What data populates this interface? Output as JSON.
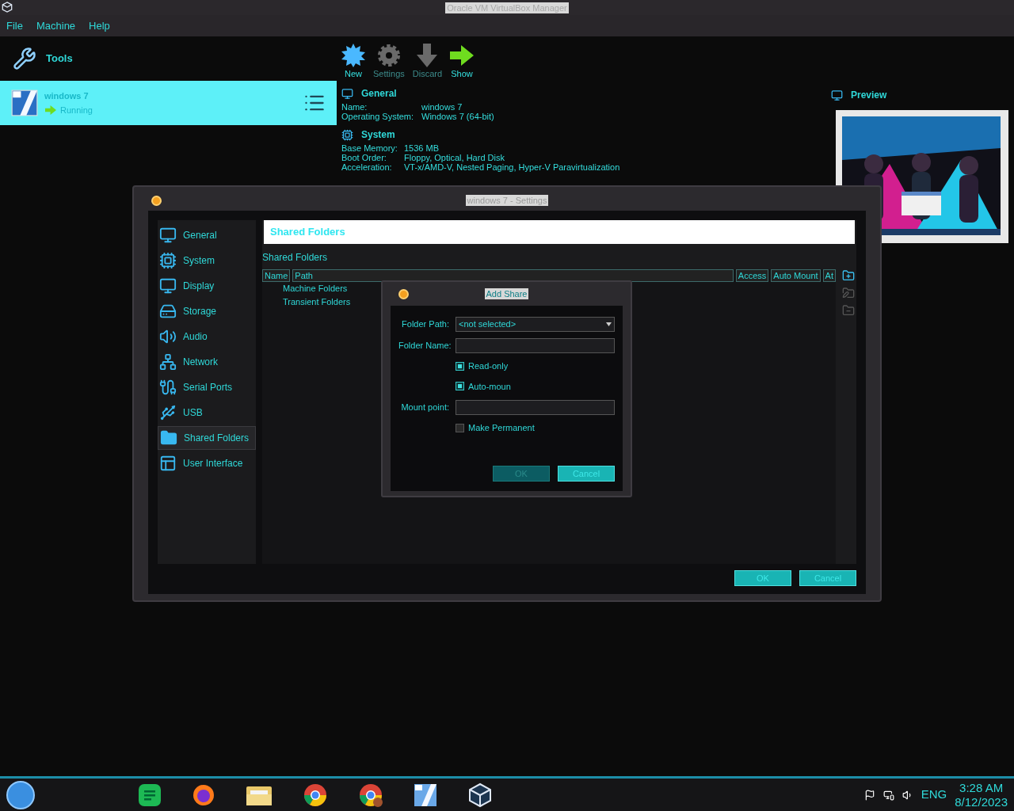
{
  "window": {
    "title": "Oracle VM VirtualBox Manager"
  },
  "menu": [
    "File",
    "Machine",
    "Help"
  ],
  "tools": {
    "label": "Tools"
  },
  "machines": [
    {
      "name": "windows 7",
      "state": "Running",
      "selected": true
    }
  ],
  "toolbar": [
    {
      "label": "New",
      "kind": "new",
      "disabled": false
    },
    {
      "label": "Settings",
      "kind": "settings",
      "disabled": true
    },
    {
      "label": "Discard",
      "kind": "discard",
      "disabled": true
    },
    {
      "label": "Show",
      "kind": "show",
      "disabled": false
    }
  ],
  "details": [
    {
      "title": "General",
      "kind": "general",
      "rows": [
        {
          "label": "Name:",
          "value": "windows 7"
        },
        {
          "label": "Operating System:",
          "value": "Windows 7 (64-bit)"
        }
      ]
    },
    {
      "title": "System",
      "kind": "system",
      "rows": [
        {
          "label": "Base Memory:",
          "value": "1536 MB"
        },
        {
          "label": "Boot Order:",
          "value": "Floppy, Optical, Hard Disk"
        },
        {
          "label": "Acceleration:",
          "value": "VT-x/AMD-V, Nested Paging, Hyper-V Paravirtualization"
        }
      ]
    }
  ],
  "preview": {
    "title": "Preview",
    "kind": "picture"
  },
  "settings_dialog": {
    "title": "windows 7 - Settings",
    "nav": [
      {
        "label": "General",
        "kind": "general",
        "selected": false
      },
      {
        "label": "System",
        "kind": "system",
        "selected": false
      },
      {
        "label": "Display",
        "kind": "display",
        "selected": false
      },
      {
        "label": "Storage",
        "kind": "storage",
        "selected": false
      },
      {
        "label": "Audio",
        "kind": "audio",
        "selected": false
      },
      {
        "label": "Network",
        "kind": "network",
        "selected": false
      },
      {
        "label": "Serial Ports",
        "kind": "serial",
        "selected": false
      },
      {
        "label": "USB",
        "kind": "usb",
        "selected": false
      },
      {
        "label": "Shared Folders",
        "kind": "folders",
        "selected": true
      },
      {
        "label": "User Interface",
        "kind": "ui",
        "selected": false
      }
    ],
    "page_title": "Shared Folders",
    "group_label": "Shared Folders",
    "columns": [
      "Name",
      "Path",
      "Access",
      "Auto Mount",
      "At"
    ],
    "rows": [
      "Machine Folders",
      "Transient Folders"
    ],
    "side_buttons": [
      {
        "kind": "add",
        "disabled": false
      },
      {
        "kind": "edit",
        "disabled": true
      },
      {
        "kind": "remove",
        "disabled": true
      }
    ],
    "buttons": [
      {
        "label": "OK"
      },
      {
        "label": "Cancel"
      }
    ]
  },
  "add_share": {
    "title": "Add Share",
    "fields": [
      {
        "kind": "select",
        "label": "Folder Path:",
        "value": "<not selected>"
      },
      {
        "kind": "text",
        "label": "Folder Name:"
      },
      {
        "kind": "checkbox",
        "label": "Read-only",
        "checked": true
      },
      {
        "kind": "checkbox",
        "label": "Auto-moun",
        "checked": true
      },
      {
        "kind": "text",
        "label": "Mount point:"
      },
      {
        "kind": "checkbox",
        "label": "Make Permanent",
        "checked": false
      }
    ],
    "buttons": [
      {
        "label": "OK",
        "disabled": true
      },
      {
        "label": "Cancel",
        "disabled": false
      }
    ]
  },
  "taskbar": {
    "apps": [
      {
        "kind": "notes"
      },
      {
        "kind": "fox"
      },
      {
        "kind": "folder"
      },
      {
        "kind": "ring"
      },
      {
        "kind": "ring-user"
      },
      {
        "kind": "tile"
      },
      {
        "kind": "cube"
      }
    ],
    "language": "ENG",
    "time": "3:28 AM",
    "date": "8/12/2023"
  }
}
